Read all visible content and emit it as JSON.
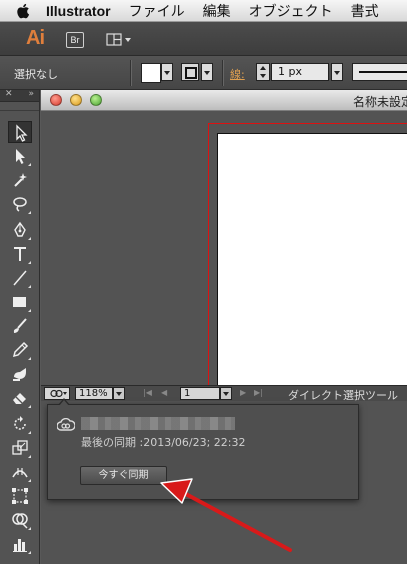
{
  "menubar": {
    "app_name": "Illustrator",
    "items": [
      "ファイル",
      "編集",
      "オブジェクト",
      "書式"
    ]
  },
  "appbar": {
    "logo": "Ai",
    "bridge_label": "Br"
  },
  "controlbar": {
    "selection_label": "選択なし",
    "stroke_label": "線:",
    "stroke_weight": "1 px"
  },
  "document": {
    "title": "名称未設定",
    "zoom": "118%",
    "page": "1",
    "status_text": "ダイレクト選択ツール"
  },
  "sync_popover": {
    "last_sync": "最後の同期 :2013/06/23; 22:32",
    "sync_now_label": "今すぐ同期"
  },
  "colors": {
    "annotation_arrow": "#d81a1a",
    "artboard_bleed": "#dd1111",
    "ai_logo": "#e07f3c"
  }
}
